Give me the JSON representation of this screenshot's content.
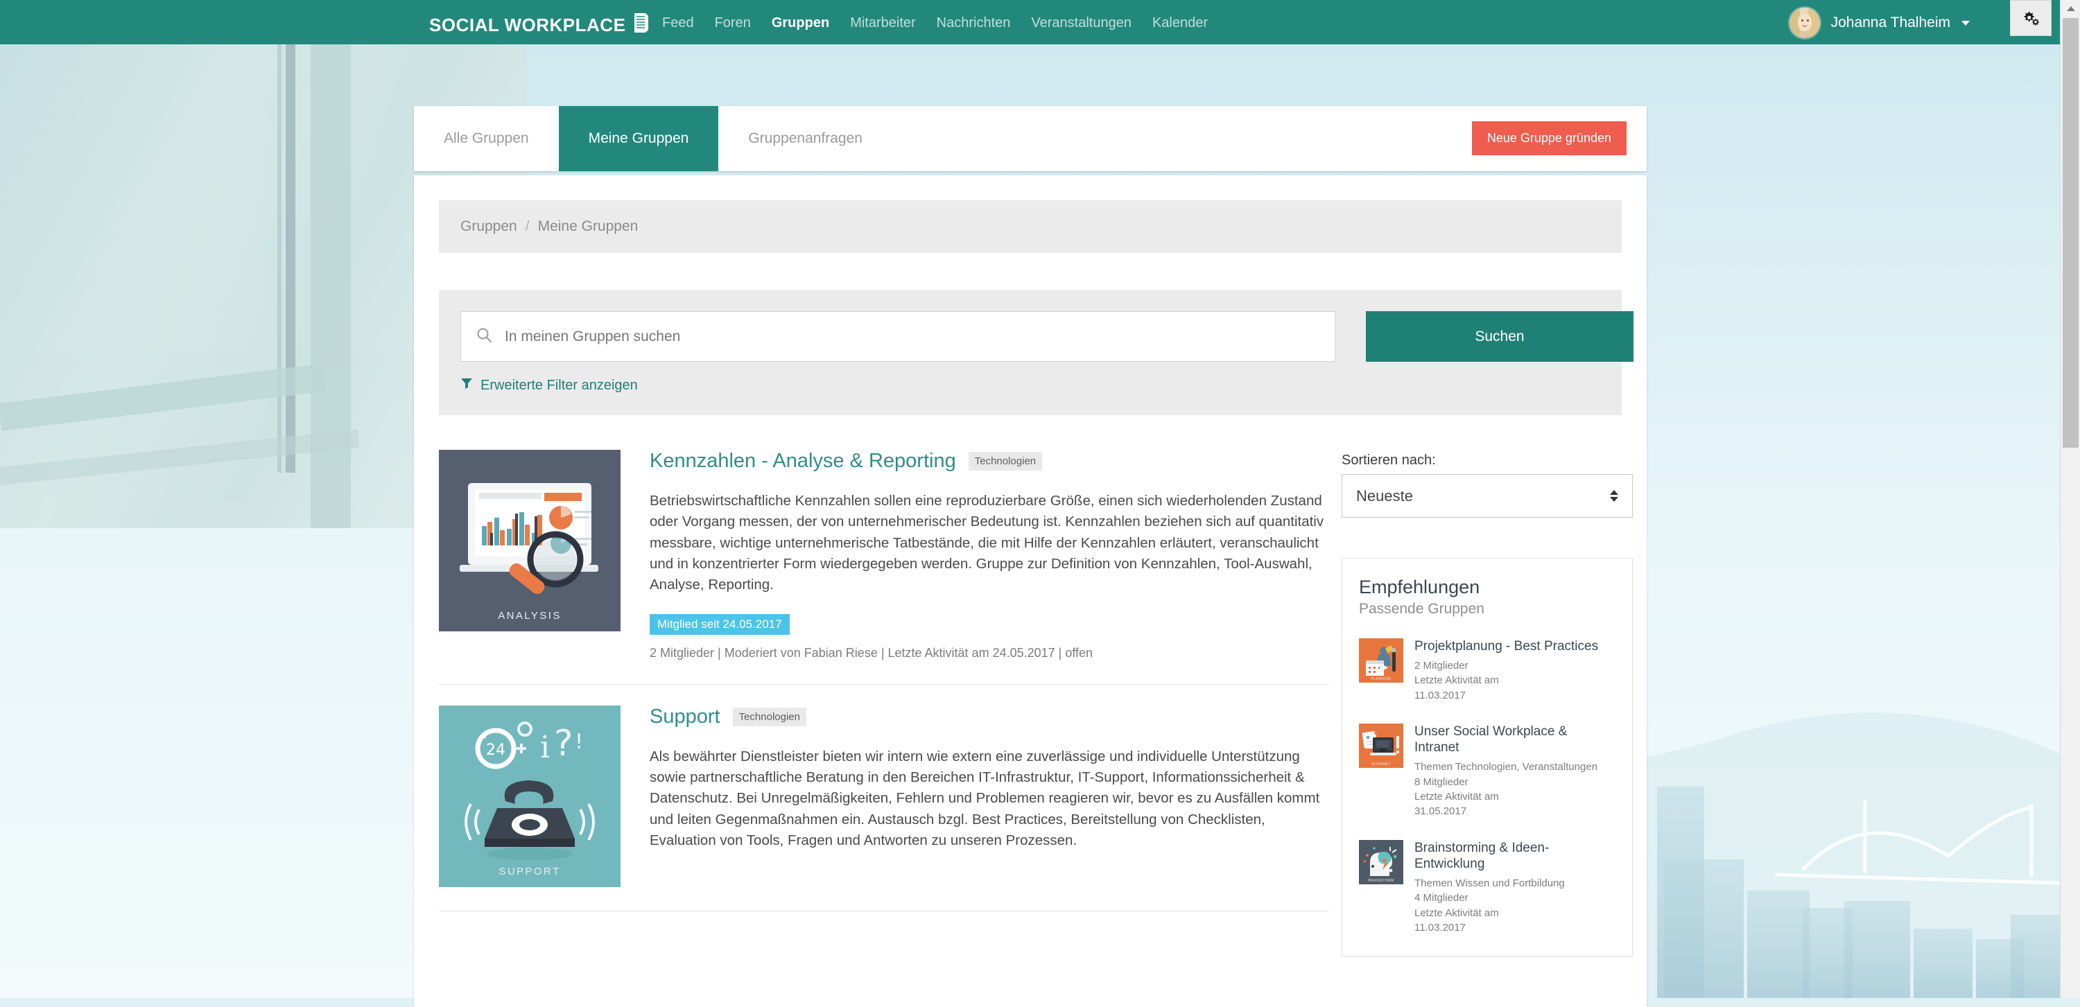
{
  "brand": {
    "name": "SOCIAL WORKPLACE",
    "icon": "document-icon"
  },
  "nav": {
    "items": [
      {
        "label": "Feed",
        "active": false
      },
      {
        "label": "Foren",
        "active": false
      },
      {
        "label": "Gruppen",
        "active": true
      },
      {
        "label": "Mitarbeiter",
        "active": false
      },
      {
        "label": "Nachrichten",
        "active": false
      },
      {
        "label": "Veranstaltungen",
        "active": false
      },
      {
        "label": "Kalender",
        "active": false
      }
    ]
  },
  "user": {
    "name": "Johanna Thalheim",
    "avatar": "user-avatar",
    "caret": "chevron-down-icon"
  },
  "window_controls": {
    "gear": "gears-icon"
  },
  "tabs": {
    "items": [
      {
        "label": "Alle Gruppen",
        "active": false
      },
      {
        "label": "Meine Gruppen",
        "active": true
      },
      {
        "label": "Gruppenanfragen",
        "active": false
      }
    ],
    "new_group_label": "Neue Gruppe gründen"
  },
  "breadcrumb": {
    "root": "Gruppen",
    "separator": "/",
    "current": "Meine Gruppen"
  },
  "search": {
    "placeholder": "In meinen Gruppen suchen",
    "value": "",
    "button_label": "Suchen",
    "filter_label": "Erweiterte Filter anzeigen",
    "search_icon": "search-icon",
    "filter_icon": "funnel-icon"
  },
  "sort": {
    "label": "Sortieren nach:",
    "selected": "Neueste"
  },
  "groups": [
    {
      "title": "Kennzahlen - Analyse & Reporting",
      "tag": "Technologien",
      "description": "Betriebswirtschaftliche Kennzahlen sollen eine reproduzierbare Größe, einen sich wiederholenden Zustand oder Vorgang messen, der von unternehmerischer Bedeutung ist. Kennzahlen beziehen sich auf quantitativ messbare, wichtige unternehmerische Tatbestände, die mit Hilfe der Kennzahlen erläutert, veranschaulicht und in konzentrierter Form wiedergegeben werden. Gruppe zur Definition von Kennzahlen, Tool-Auswahl, Analyse, Reporting.",
      "badge": "Mitglied seit 24.05.2017",
      "meta": "2 Mitglieder | Moderiert von Fabian Riese | Letzte Aktivität am 24.05.2017 | offen",
      "thumb_caption": "ANALYSIS",
      "thumb_style": "analysis"
    },
    {
      "title": "Support",
      "tag": "Technologien",
      "description": "Als bewährter Dienstleister bieten wir intern wie extern eine zuverlässige und individuelle Unterstützung sowie partnerschaftliche Beratung in den Bereichen IT-Infrastruktur, IT-Support, Informationssicherheit & Datenschutz. Bei Unregelmäßigkeiten, Fehlern und Problemen reagieren wir, bevor es zu Ausfällen kommt und leiten Gegenmaßnahmen ein. Austausch bzgl. Best Practices, Bereitstellung von Checklisten, Evaluation von Tools, Fragen und Antworten zu unseren Prozessen.",
      "badge": "",
      "meta": "",
      "thumb_caption": "SUPPORT",
      "thumb_style": "support"
    }
  ],
  "recommendations": {
    "title": "Empfehlungen",
    "subtitle": "Passende Gruppen",
    "items": [
      {
        "name": "Projektplanung - Best Practices",
        "meta": "2 Mitglieder\nLetzte Aktivität am\n11.03.2017",
        "thumb_caption": "PLANNING",
        "thumb_style": "orange"
      },
      {
        "name": "Unser Social Workplace & Intranet",
        "meta": "Themen Technologien, Veranstaltungen\n8 Mitglieder\nLetzte Aktivität am\n31.05.2017",
        "thumb_caption": "INTRANET",
        "thumb_style": "orange"
      },
      {
        "name": "Brainstorming & Ideen-Entwicklung",
        "meta": "Themen Wissen und Fortbildung\n4 Mitglieder\nLetzte Aktivität am\n11.03.2017",
        "thumb_caption": "BRAINSTORM",
        "thumb_style": "dark"
      }
    ]
  },
  "colors": {
    "brand_green": "#23887c",
    "accent_red": "#ef5d4f",
    "link_teal": "#2f8e87",
    "badge_blue": "#4cc3e8",
    "tag_grey": "#e9e9e9"
  }
}
